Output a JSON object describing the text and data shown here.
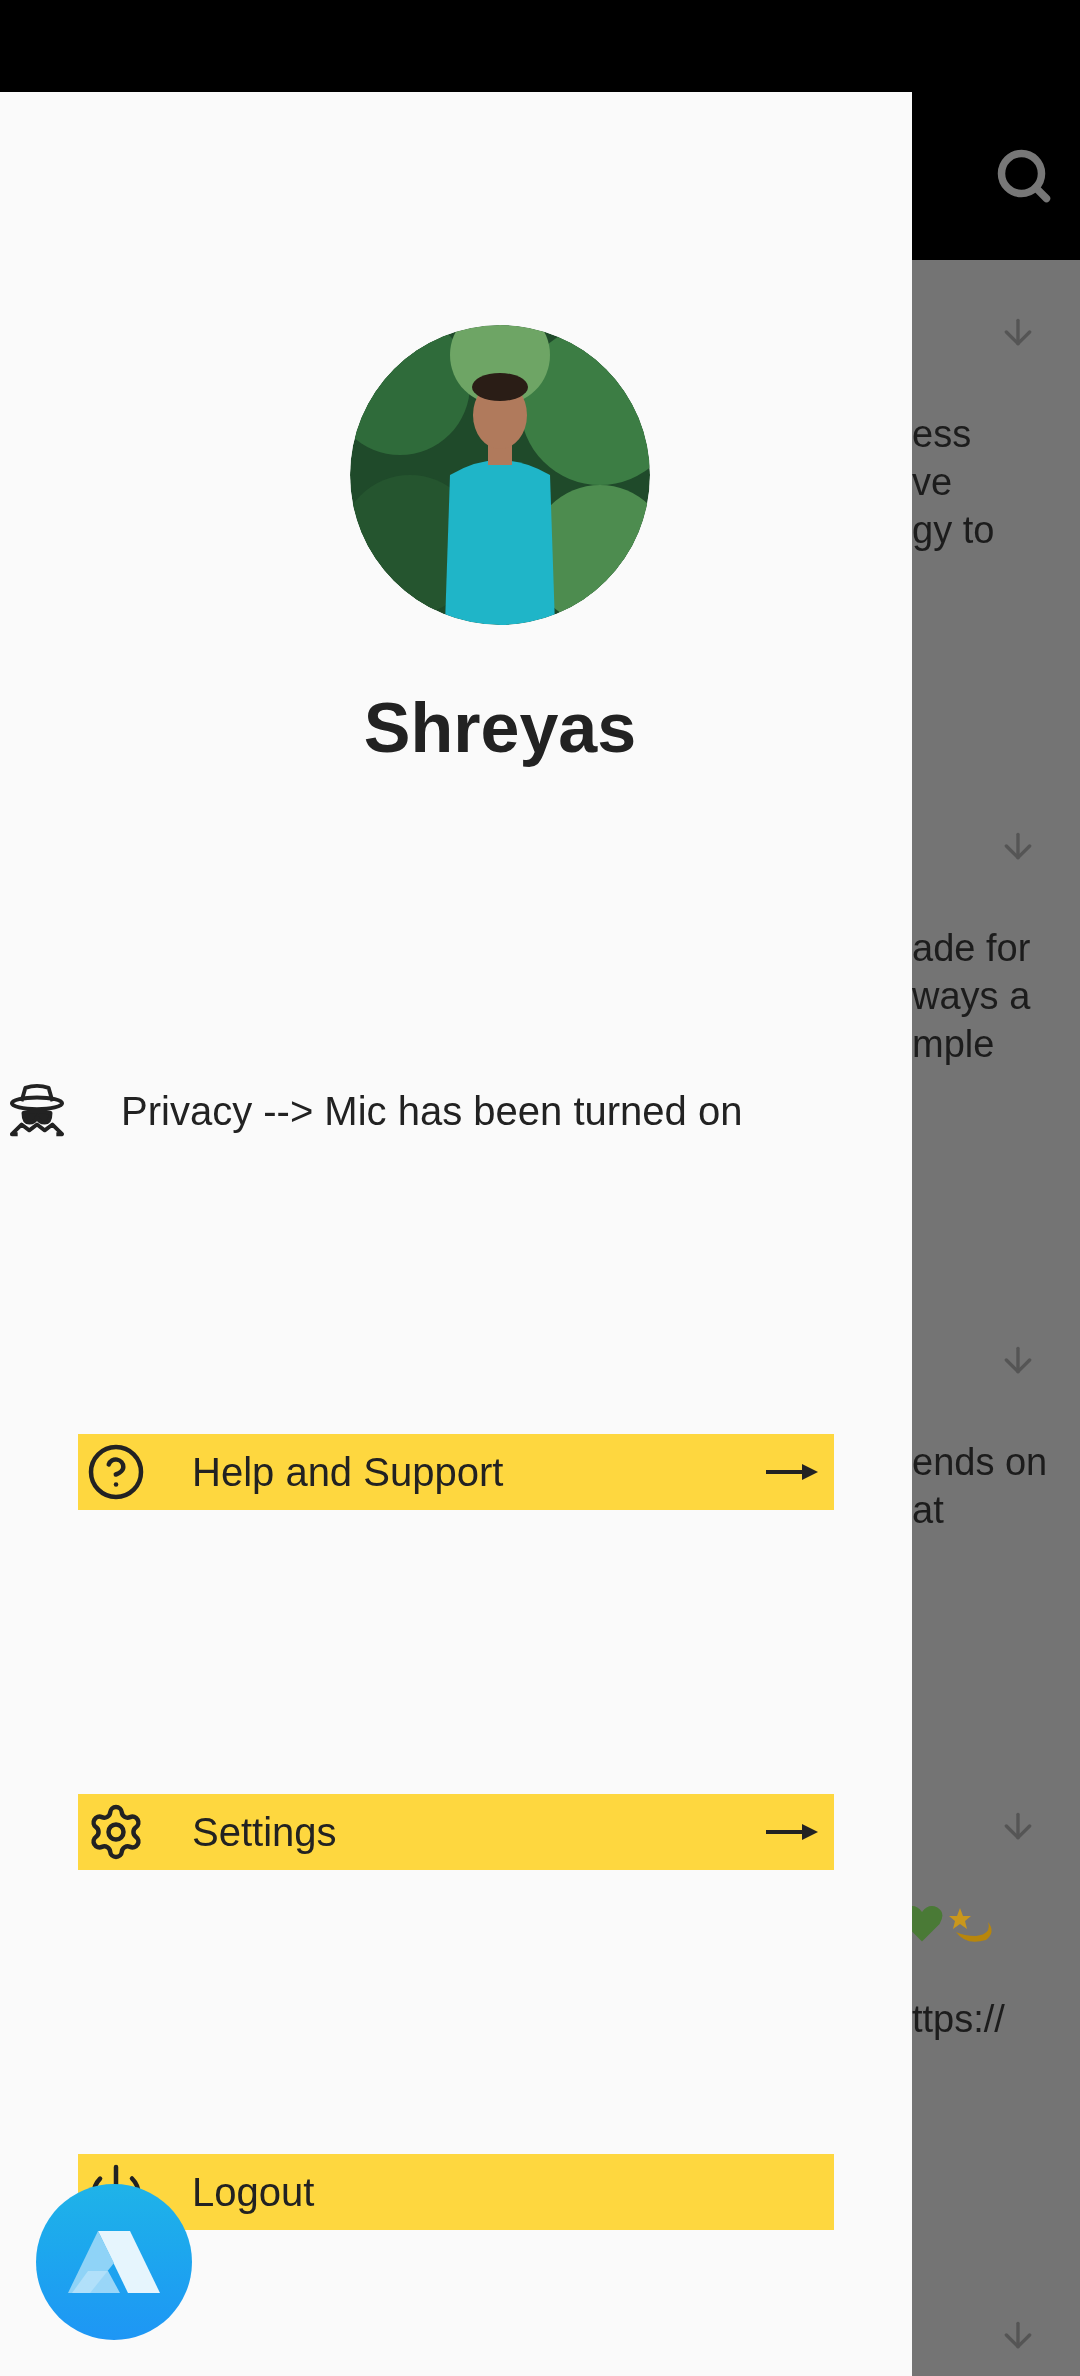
{
  "profile": {
    "name": "Shreyas"
  },
  "notice": {
    "text": "Privacy --> Mic has been turned on"
  },
  "menu": [
    {
      "kind": "help",
      "label": "Help and Support",
      "arrow": true
    },
    {
      "kind": "settings",
      "label": "Settings",
      "arrow": true
    },
    {
      "kind": "logout",
      "label": "Logout",
      "arrow": false
    }
  ],
  "feed": [
    {
      "kind": "text",
      "lines": [
        "ess",
        "ve",
        "gy to"
      ]
    },
    {
      "kind": "text",
      "lines": [
        "ade for",
        "ways a",
        "mple"
      ]
    },
    {
      "kind": "text",
      "lines": [
        "ends on",
        "at"
      ]
    },
    {
      "kind": "emoji",
      "lines": [
        "ttps://"
      ]
    },
    {
      "kind": "collapsed"
    }
  ]
}
